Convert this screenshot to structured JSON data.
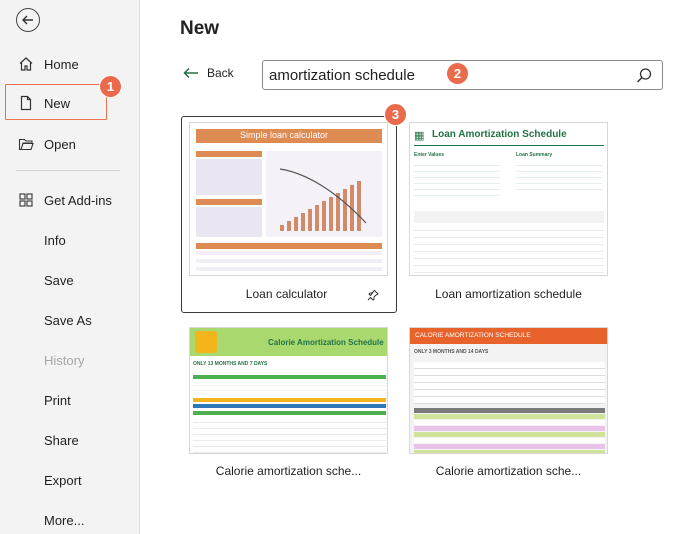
{
  "sidebar": {
    "home": "Home",
    "new": "New",
    "open": "Open",
    "get_addins": "Get Add-ins",
    "info": "Info",
    "save": "Save",
    "save_as": "Save As",
    "history": "History",
    "print": "Print",
    "share": "Share",
    "export": "Export",
    "more": "More..."
  },
  "header": {
    "title": "New"
  },
  "back_label": "Back",
  "search": {
    "value": "amortization schedule"
  },
  "badges": {
    "b1": "1",
    "b2": "2",
    "b3": "3"
  },
  "templates": [
    {
      "caption": "Loan calculator",
      "thumb_title": "Simple loan calculator"
    },
    {
      "caption": "Loan amortization schedule",
      "thumb_title": "Loan Amortization Schedule",
      "left_header": "Enter Values",
      "right_header": "Loan Summary"
    },
    {
      "caption": "Calorie amortization sche...",
      "thumb_title": "Calorie Amortization Schedule",
      "subtitle": "ONLY 13 MONTHS AND 7 DAYS"
    },
    {
      "caption": "Calorie amortization sche...",
      "thumb_title": "CALORIE AMORTIZATION SCHEDULE",
      "subtitle": "ONLY 3 MONTHS AND 14 DAYS"
    }
  ],
  "colors": {
    "accent_orange": "#ea6a4b",
    "loan_calc_orange": "#de8a53",
    "loan_amort_green": "#217346",
    "calorie_green": "#4caf50",
    "calorie_orange": "#e8632b"
  },
  "icons": [
    "back-arrow-icon",
    "home-icon",
    "new-doc-icon",
    "open-folder-icon",
    "addins-grid-icon",
    "left-arrow-icon",
    "search-icon",
    "pin-icon"
  ]
}
